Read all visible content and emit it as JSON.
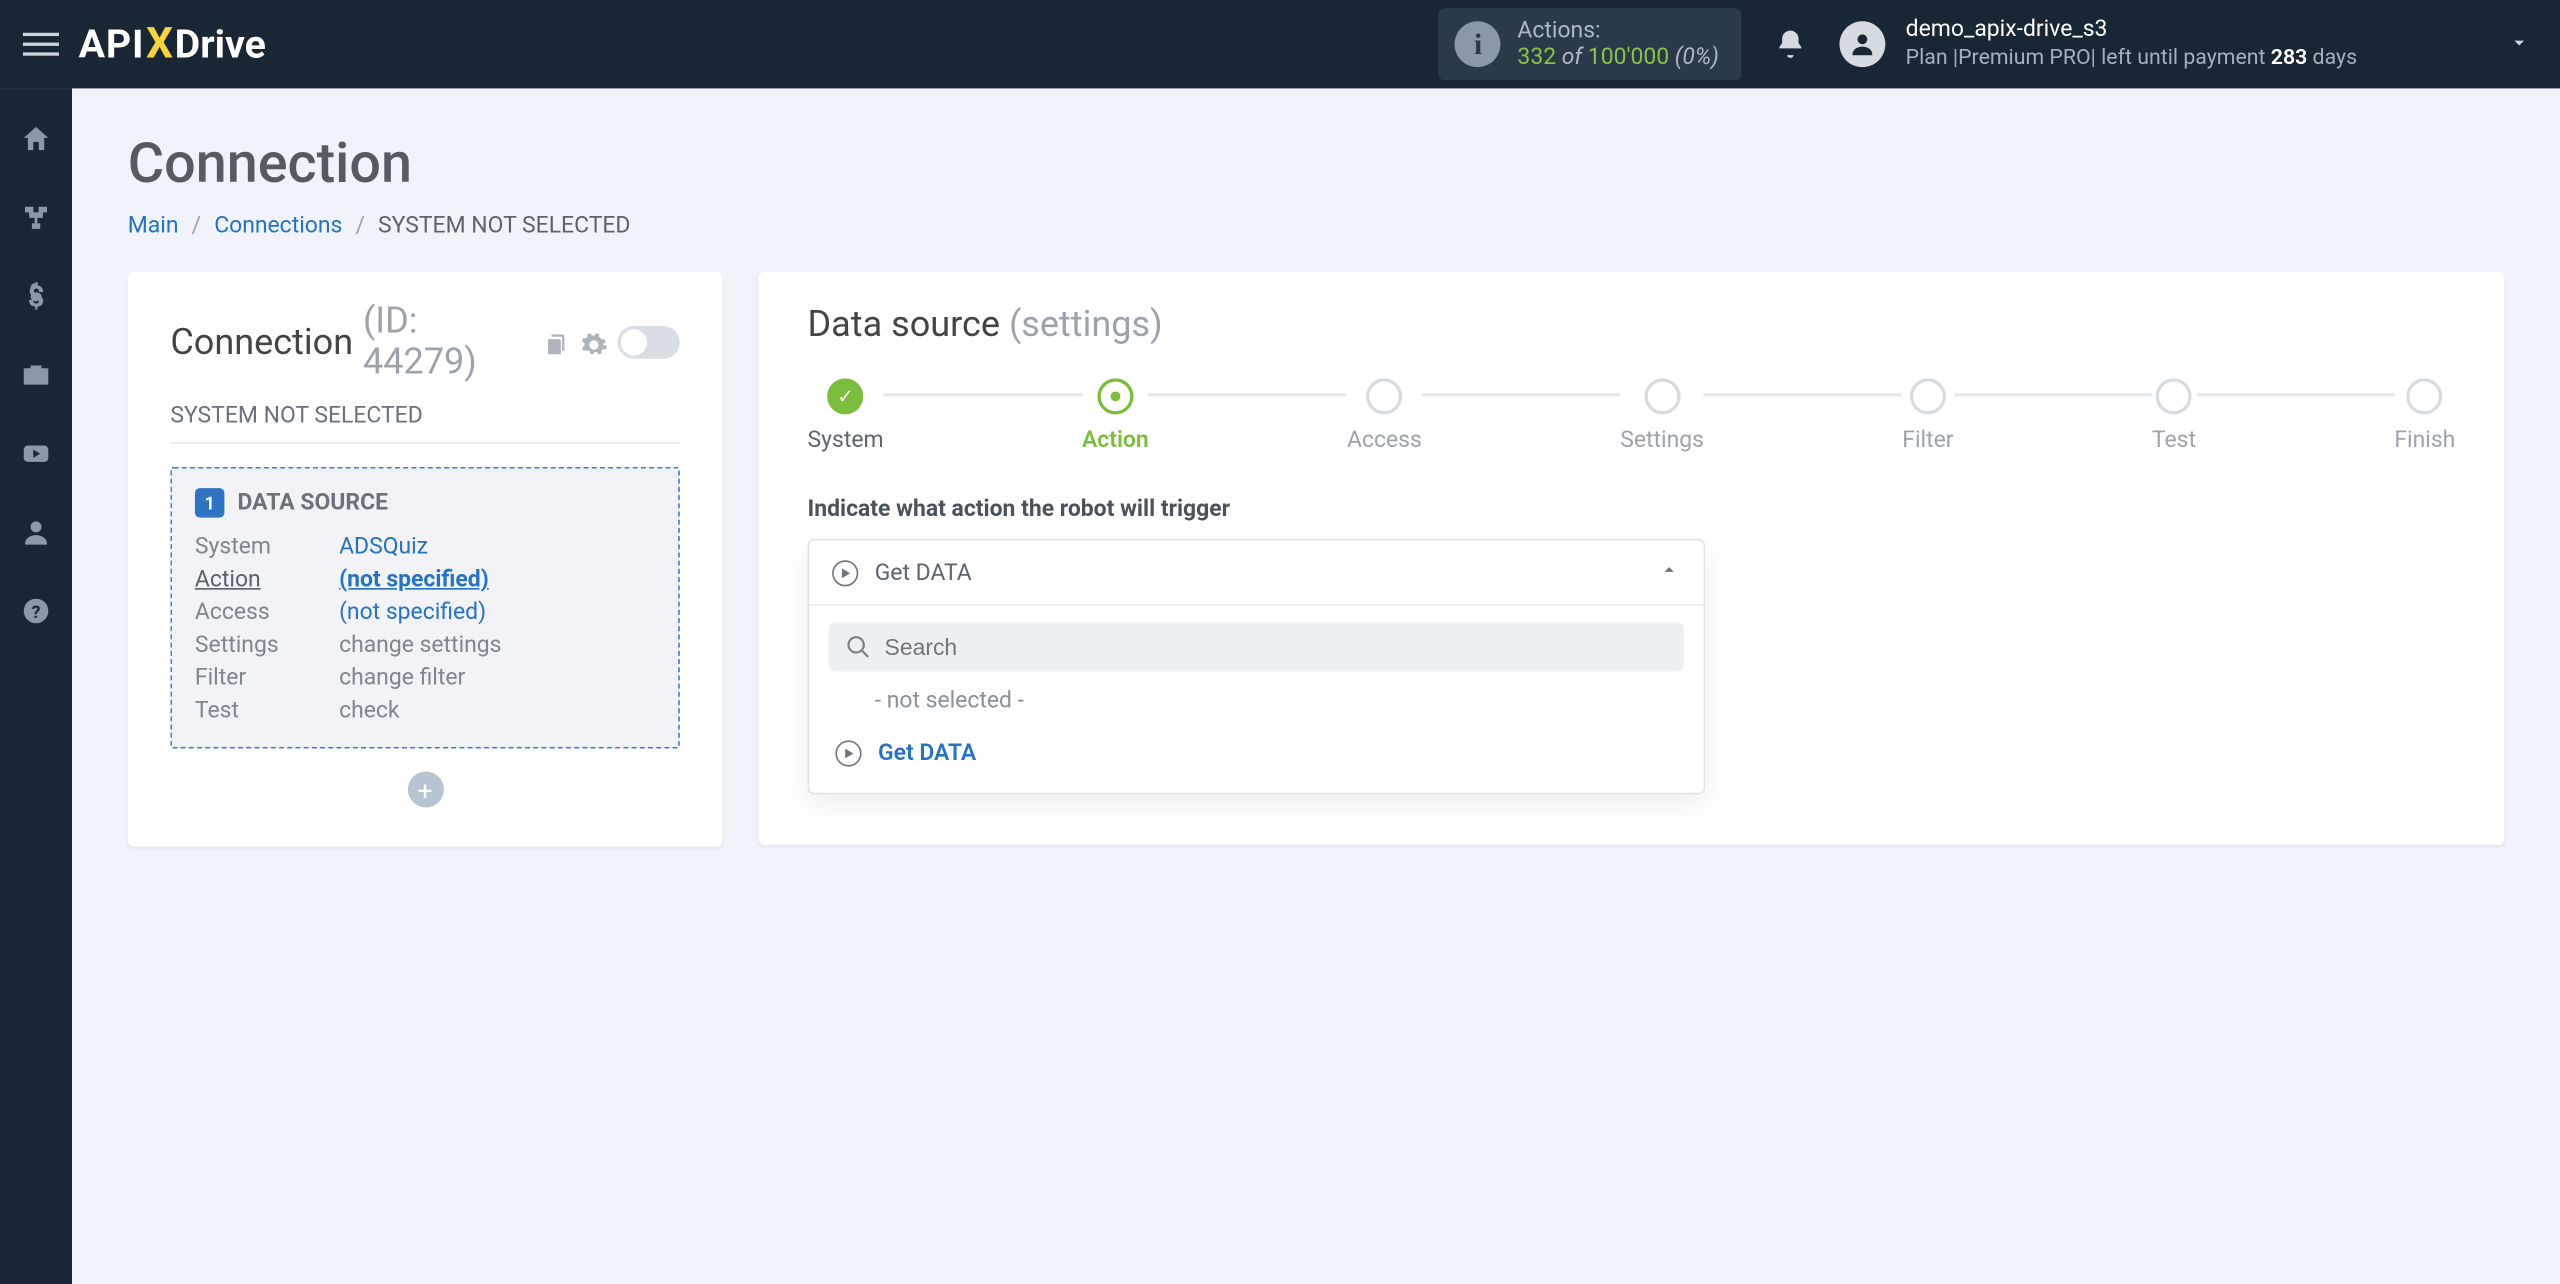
{
  "topbar": {
    "logo": {
      "api": "API",
      "x": "X",
      "drive": "Drive"
    },
    "actions_label": "Actions:",
    "actions_used": "332",
    "actions_of": " of ",
    "actions_total": "100'000",
    "actions_pct": " (0%)",
    "user": {
      "name": "demo_apix-drive_s3",
      "plan_prefix": "Plan |",
      "plan_name": "Premium PRO",
      "plan_mid": "| left until payment ",
      "plan_days": "283",
      "plan_suffix": " days"
    }
  },
  "page": {
    "title": "Connection",
    "breadcrumb": {
      "main": "Main",
      "connections": "Connections",
      "current": "SYSTEM NOT SELECTED"
    }
  },
  "leftcard": {
    "title": "Connection",
    "idlabel": "(ID: 44279)",
    "subtitle": "SYSTEM NOT SELECTED",
    "ds_badge": "1",
    "ds_title": "DATA SOURCE",
    "rows": {
      "system_k": "System",
      "system_v": "ADSQuiz",
      "action_k": "Action",
      "action_v": "(not specified)",
      "access_k": "Access",
      "access_v": "(not specified)",
      "settings_k": "Settings",
      "settings_v": "change settings",
      "filter_k": "Filter",
      "filter_v": "change filter",
      "test_k": "Test",
      "test_v": "check"
    }
  },
  "rightcard": {
    "title": "Data source",
    "title_muted": "(settings)",
    "steps": [
      "System",
      "Action",
      "Access",
      "Settings",
      "Filter",
      "Test",
      "Finish"
    ],
    "field_label": "Indicate what action the robot will trigger",
    "selected": "Get DATA",
    "search_placeholder": "Search",
    "opt_notsel": "- not selected -",
    "opt_get": "Get DATA"
  }
}
